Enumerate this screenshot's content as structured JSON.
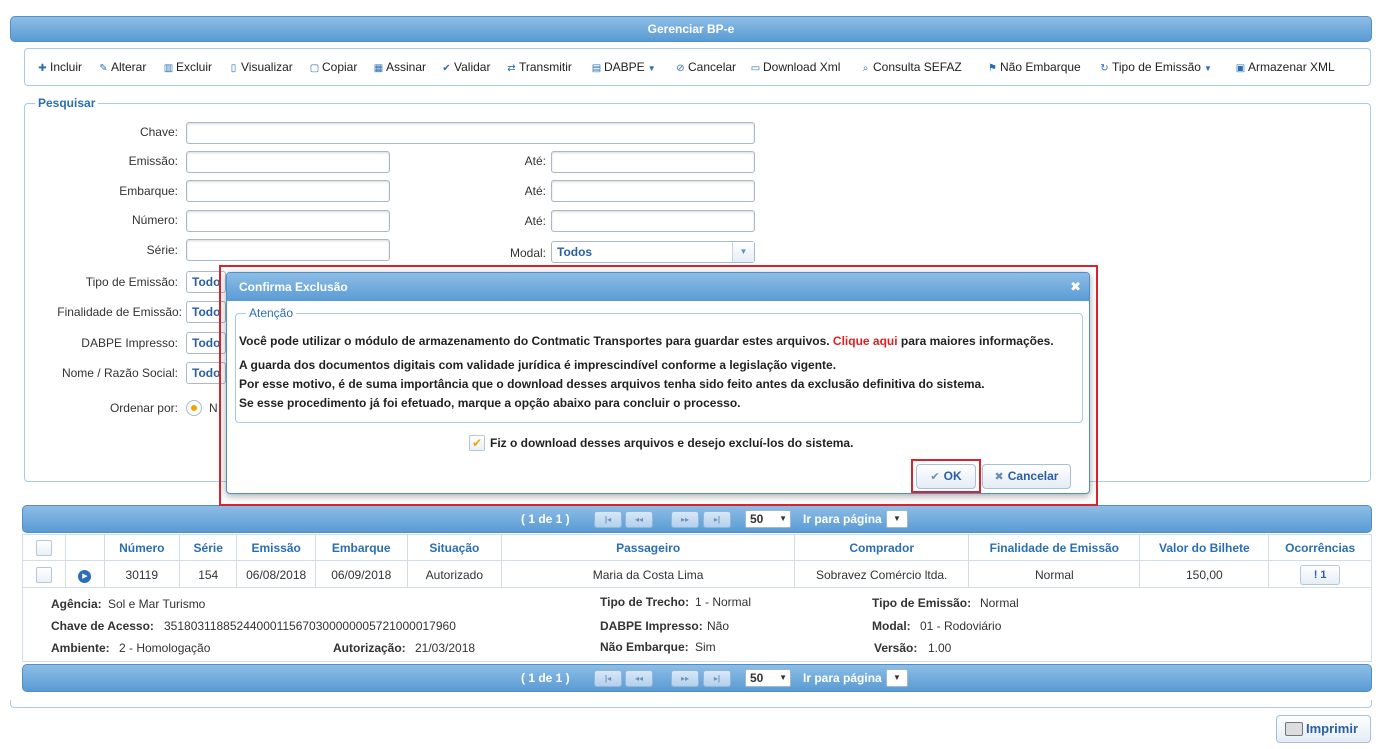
{
  "app": {
    "title": "Gerenciar BP-e"
  },
  "toolbar": {
    "items": [
      {
        "label": "Incluir",
        "icon": "plus-icon"
      },
      {
        "label": "Alterar",
        "icon": "pencil-icon"
      },
      {
        "label": "Excluir",
        "icon": "trash-icon"
      },
      {
        "label": "Visualizar",
        "icon": "document-icon"
      },
      {
        "label": "Copiar",
        "icon": "clipboard-icon"
      },
      {
        "label": "Assinar",
        "icon": "signature-icon"
      },
      {
        "label": "Validar",
        "icon": "check-icon"
      },
      {
        "label": "Transmitir",
        "icon": "transfer-icon"
      },
      {
        "label": "DABPE",
        "icon": "printer-icon"
      },
      {
        "label": "Cancelar",
        "icon": "cancel-icon"
      },
      {
        "label": "Download Xml",
        "icon": "folder-icon"
      },
      {
        "label": "Consulta SEFAZ",
        "icon": "search-icon"
      },
      {
        "label": "Não Embarque",
        "icon": "flag-icon"
      },
      {
        "label": "Tipo de Emissão",
        "icon": "refresh-icon"
      },
      {
        "label": "Armazenar XML",
        "icon": "save-icon"
      }
    ]
  },
  "search": {
    "legend": "Pesquisar",
    "chave": "Chave:",
    "emissao": "Emissão:",
    "embarque": "Embarque:",
    "numero": "Número:",
    "serie": "Série:",
    "ate": "Até:",
    "modal": "Modal:",
    "modal_value": "Todos",
    "tipo_emissao": "Tipo de Emissão:",
    "finalidade": "Finalidade de Emissão:",
    "dabpe_impresso": "DABPE Impresso:",
    "nome": "Nome / Razão Social:",
    "ordenar": "Ordenar por:",
    "todos": "Todo",
    "ordenar_value": "N"
  },
  "pager": {
    "info": "( 1 de 1 )",
    "first": "|◂",
    "prev": "◂◂",
    "next": "▸▸",
    "last": "▸|",
    "page_size": "50",
    "goto_label": "Ir para página"
  },
  "grid": {
    "headers": [
      "Número",
      "Série",
      "Emissão",
      "Embarque",
      "Situação",
      "Passageiro",
      "Comprador",
      "Finalidade de Emissão",
      "Valor do Bilhete",
      "Ocorrências"
    ],
    "row": {
      "numero": "30119",
      "serie": "154",
      "emissao": "06/08/2018",
      "embarque": "06/09/2018",
      "situacao": "Autorizado",
      "passageiro": "Maria da Costa Lima",
      "comprador": "Sobravez Comércio ltda.",
      "finalidade": "Normal",
      "valor": "150,00",
      "ocorrencias": "1"
    }
  },
  "details": {
    "agencia_k": "Agência:",
    "agencia_v": "Sol e Mar Turismo",
    "chave_k": "Chave de Acesso:",
    "chave_v": "35180311885244000115670300000005721000017960",
    "ambiente_k": "Ambiente:",
    "ambiente_v": "2 - Homologação",
    "autorizacao_k": "Autorização:",
    "autorizacao_v": "21/03/2018",
    "tipo_trecho_k": "Tipo de Trecho:",
    "tipo_trecho_v": "1 - Normal",
    "dabpe_k": "DABPE Impresso:",
    "dabpe_v": "Não",
    "nao_embarque_k": "Não Embarque:",
    "nao_embarque_v": "Sim",
    "tipo_emissao_k": "Tipo de Emissão:",
    "tipo_emissao_v": "Normal",
    "modal_k": "Modal:",
    "modal_v": "01 - Rodoviário",
    "versao_k": "Versão:",
    "versao_v": "1.00"
  },
  "print": {
    "label": "Imprimir"
  },
  "dialog": {
    "title": "Confirma Exclusão",
    "legend": "Atenção",
    "line1_a": "Você pode utilizar o módulo de armazenamento do Contmatic Transportes para guardar estes arquivos. ",
    "line1_link": "Clique aqui",
    "line1_b": " para maiores informações.",
    "line2": "A guarda dos documentos digitais com validade jurídica é imprescindível conforme a legislação vigente.",
    "line3": "Por esse motivo, é de suma importância que o download desses arquivos tenha sido feito antes da exclusão definitiva do sistema.",
    "line4": "Se esse procedimento já foi efetuado, marque a opção abaixo para concluir o processo.",
    "checkbox_label": "Fiz o download desses arquivos e desejo excluí-los do sistema.",
    "ok": "OK",
    "cancel": "Cancelar"
  },
  "colors": {
    "accent": "#2a6fb4",
    "header_bg": "#5a9bd4",
    "highlight": "#d9232d",
    "link_red": "#e02020",
    "radio": "#f0a500"
  }
}
